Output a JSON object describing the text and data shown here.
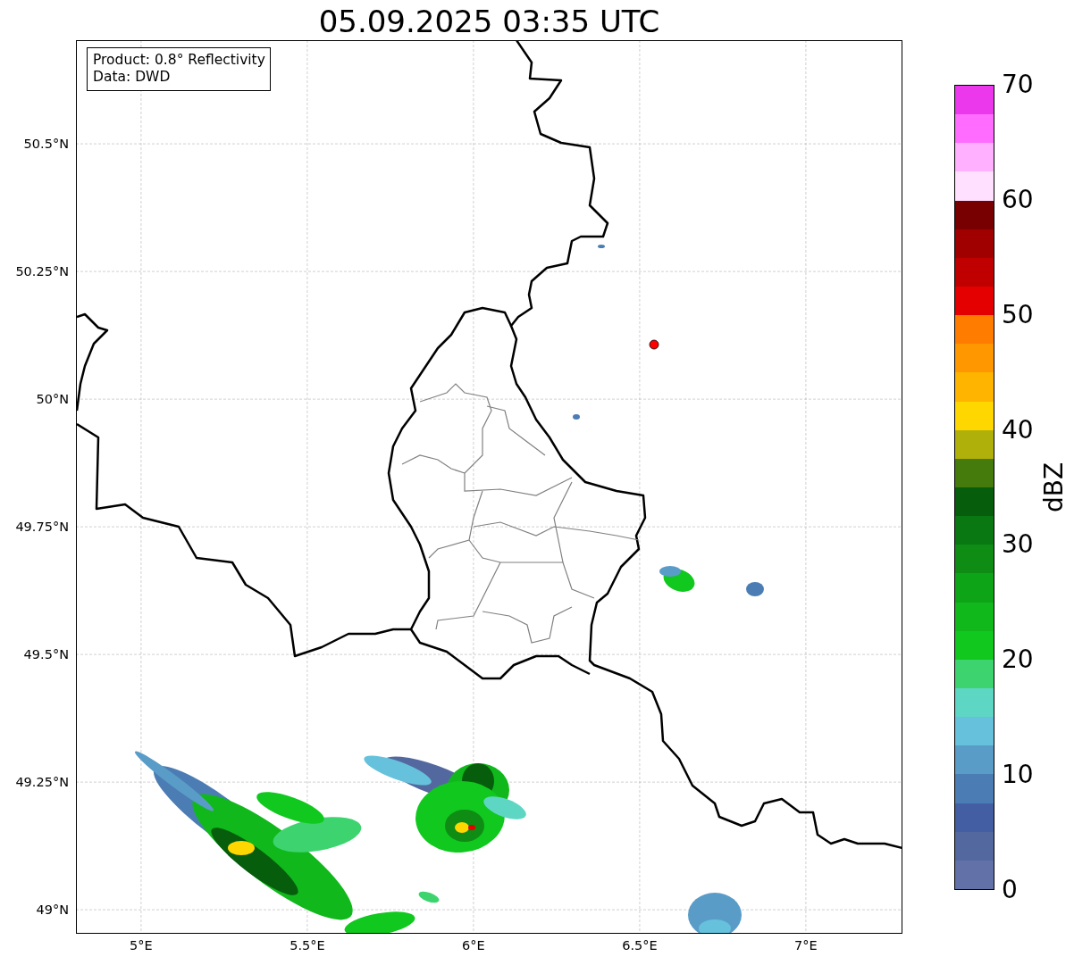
{
  "title": "05.09.2025 03:35 UTC",
  "annotation": [
    "Product: 0.8° Reflectivity",
    "Data: DWD"
  ],
  "map": {
    "y_ticks": [
      "50.5°N",
      "50.25°N",
      "50°N",
      "49.75°N",
      "49.5°N",
      "49.25°N",
      "49°N"
    ],
    "x_ticks": [
      "5°E",
      "5.5°E",
      "6°E",
      "6.5°E",
      "7°E"
    ]
  },
  "colorbar": {
    "label": "dBZ",
    "ticks": [
      "70",
      "60",
      "50",
      "40",
      "30",
      "20",
      "10",
      "0"
    ],
    "segments": [
      {
        "color": "#ec38ec"
      },
      {
        "color": "#ff6cff"
      },
      {
        "color": "#ffb0ff"
      },
      {
        "color": "#ffe0ff"
      },
      {
        "color": "#780000"
      },
      {
        "color": "#a00000"
      },
      {
        "color": "#c00000"
      },
      {
        "color": "#e40000"
      },
      {
        "color": "#ff7c00"
      },
      {
        "color": "#ff9800"
      },
      {
        "color": "#ffb400"
      },
      {
        "color": "#ffd700"
      },
      {
        "color": "#b0b00a"
      },
      {
        "color": "#457a0c"
      },
      {
        "color": "#065e0c"
      },
      {
        "color": "#0a7812"
      },
      {
        "color": "#0e8c14"
      },
      {
        "color": "#0ea418"
      },
      {
        "color": "#10b81c"
      },
      {
        "color": "#10c81e"
      },
      {
        "color": "#3dd470"
      },
      {
        "color": "#5ed6c4"
      },
      {
        "color": "#66c2dc"
      },
      {
        "color": "#5a9cc8"
      },
      {
        "color": "#4b7db4"
      },
      {
        "color": "#445ea4"
      },
      {
        "color": "#5468a0"
      },
      {
        "color": "#6272a8"
      }
    ]
  }
}
